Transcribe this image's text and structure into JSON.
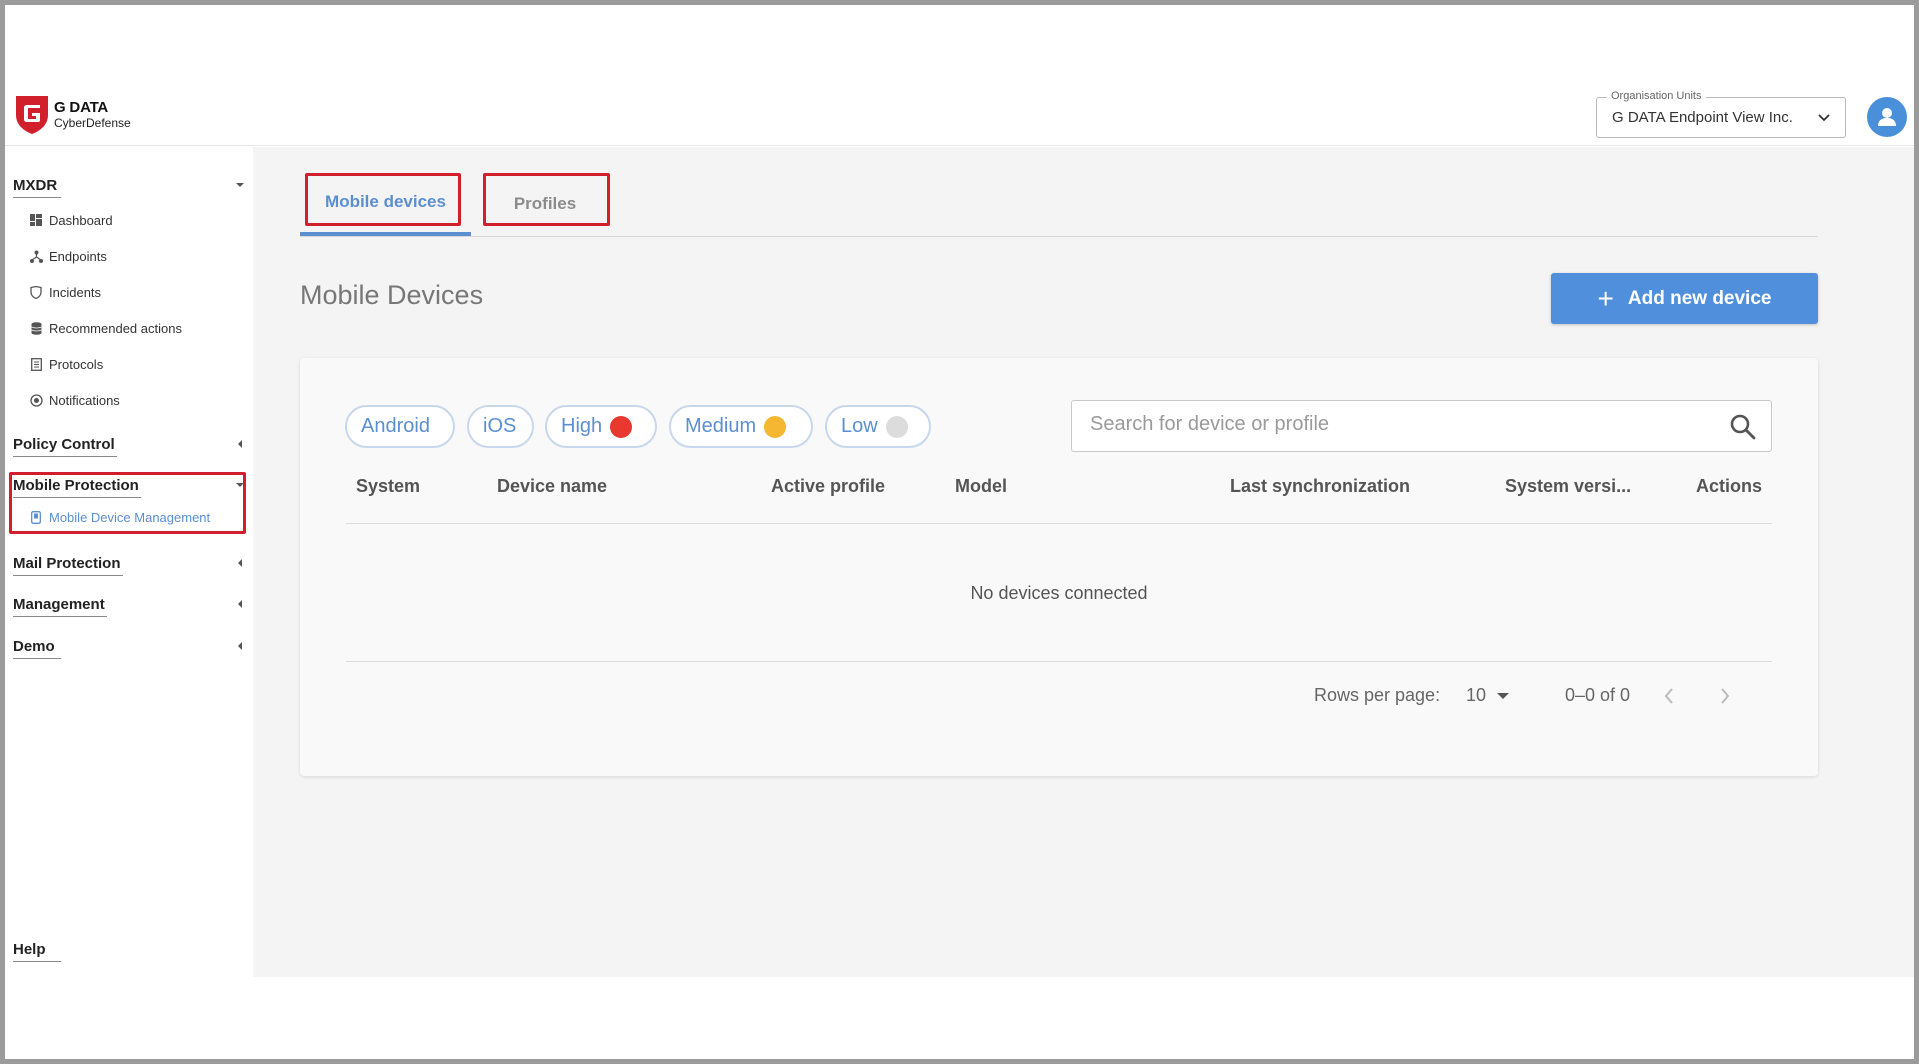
{
  "header": {
    "brand_name": "G DATA",
    "brand_sub": "CyberDefense",
    "org_legend": "Organisation Units",
    "org_value": "G DATA Endpoint View Inc."
  },
  "sidebar": {
    "sections": {
      "mxdr": "MXDR",
      "policy_control": "Policy Control",
      "mobile_protection": "Mobile Protection",
      "mail_protection": "Mail Protection",
      "management": "Management",
      "demo": "Demo",
      "help": "Help"
    },
    "mxdr_items": [
      "Dashboard",
      "Endpoints",
      "Incidents",
      "Recommended actions",
      "Protocols",
      "Notifications"
    ],
    "mobile_items": [
      "Mobile Device Management"
    ]
  },
  "tabs": [
    "Mobile devices",
    "Profiles"
  ],
  "page_title": "Mobile Devices",
  "add_button": "Add new device",
  "filters": [
    {
      "label": "Android"
    },
    {
      "label": "iOS"
    },
    {
      "label": "High",
      "color": "#e8382f"
    },
    {
      "label": "Medium",
      "color": "#f5b731"
    },
    {
      "label": "Low",
      "color": "#dcdcdc"
    }
  ],
  "search": {
    "placeholder": "Search for device or profile"
  },
  "table": {
    "columns": [
      "System",
      "Device name",
      "Active profile",
      "Model",
      "Last synchronization",
      "System versi...",
      "Actions"
    ],
    "empty_text": "No devices connected"
  },
  "pagination": {
    "rows_label": "Rows per page:",
    "rows_value": "10",
    "range": "0–0 of 0"
  },
  "colors": {
    "accent": "#5b8fcf",
    "button": "#4f8fdc",
    "highlight": "#d1202b"
  }
}
